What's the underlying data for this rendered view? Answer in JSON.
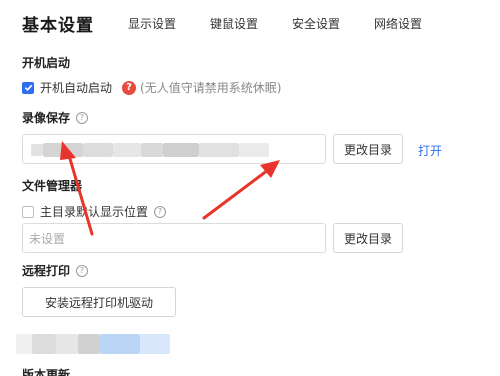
{
  "tabs": {
    "active": "基本设置",
    "items": [
      "显示设置",
      "键鼠设置",
      "安全设置",
      "网络设置"
    ]
  },
  "startup": {
    "title": "开机启动",
    "checkbox_label": "开机自动启动",
    "checked": true,
    "hint": "(无人值守请禁用系统休眠)"
  },
  "recording": {
    "title": "录像保存",
    "change_dir_label": "更改目录",
    "open_label": "打开"
  },
  "file_manager": {
    "title": "文件管理器",
    "checkbox_label": "主目录默认显示位置",
    "checked": false,
    "placeholder": "未设置",
    "change_dir_label": "更改目录"
  },
  "remote_print": {
    "title": "远程打印",
    "install_driver_label": "安装远程打印机驱动"
  },
  "version": {
    "title": "版本更新"
  },
  "colors": {
    "accent": "#2e6ff2",
    "arrow": "#e8342a",
    "warning": "#e84a3b"
  }
}
